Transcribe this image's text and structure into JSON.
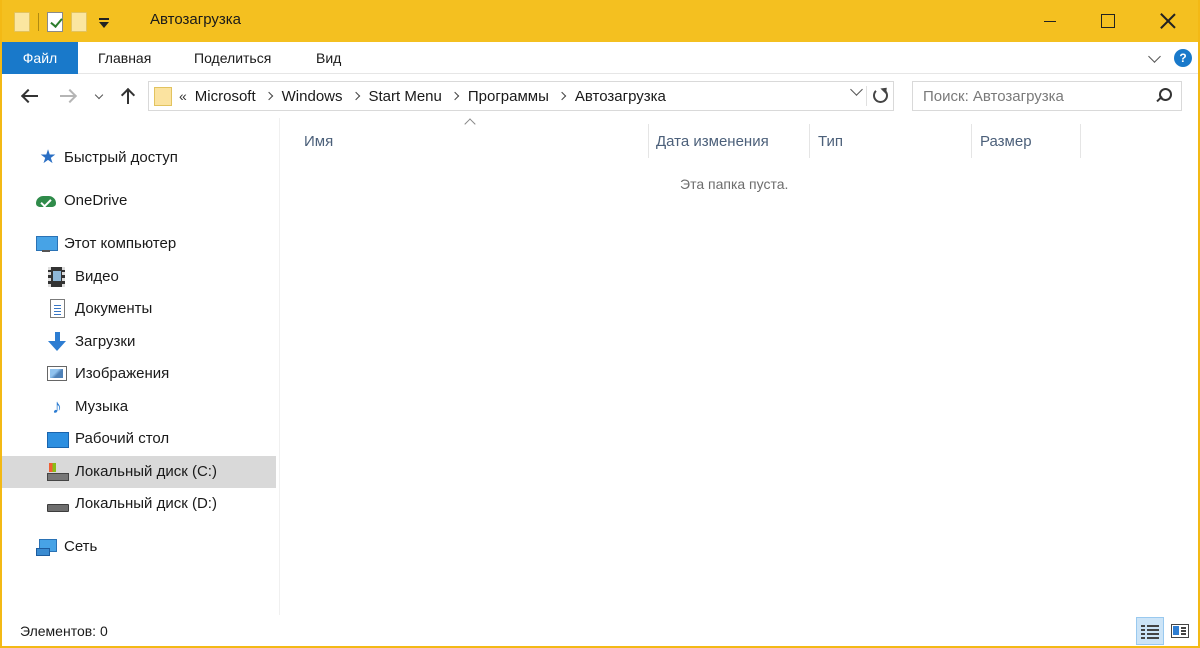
{
  "window": {
    "title": "Автозагрузка",
    "accent_color": "#f4c020",
    "qat": {
      "icons": [
        "folder-icon",
        "properties-check-icon",
        "new-folder-icon",
        "customize-dropdown-icon"
      ]
    }
  },
  "ribbon": {
    "file_label": "Файл",
    "tabs": [
      "Главная",
      "Поделиться",
      "Вид"
    ],
    "file_color": "#1979ca",
    "help_glyph": "?"
  },
  "nav": {
    "breadcrumbs_prefix": "«",
    "breadcrumbs": [
      "Microsoft",
      "Windows",
      "Start Menu",
      "Программы",
      "Автозагрузка"
    ],
    "search_placeholder": "Поиск: Автозагрузка"
  },
  "sidebar": {
    "items": [
      {
        "label": "Быстрый доступ",
        "icon": "star-icon"
      },
      {
        "label": "OneDrive",
        "icon": "onedrive-icon"
      },
      {
        "label": "Этот компьютер",
        "icon": "computer-icon"
      },
      {
        "label": "Видео",
        "icon": "video-icon"
      },
      {
        "label": "Документы",
        "icon": "documents-icon"
      },
      {
        "label": "Загрузки",
        "icon": "downloads-icon"
      },
      {
        "label": "Изображения",
        "icon": "pictures-icon"
      },
      {
        "label": "Музыка",
        "icon": "music-icon"
      },
      {
        "label": "Рабочий стол",
        "icon": "desktop-icon"
      },
      {
        "label": "Локальный диск (C:)",
        "icon": "drive-c-icon",
        "selected": true
      },
      {
        "label": "Локальный диск (D:)",
        "icon": "drive-d-icon"
      },
      {
        "label": "Сеть",
        "icon": "network-icon"
      }
    ]
  },
  "content": {
    "columns": [
      "Имя",
      "Дата изменения",
      "Тип",
      "Размер"
    ],
    "empty_message": "Эта папка пуста."
  },
  "status": {
    "items_text": "Элементов: 0",
    "active_view": "details"
  }
}
